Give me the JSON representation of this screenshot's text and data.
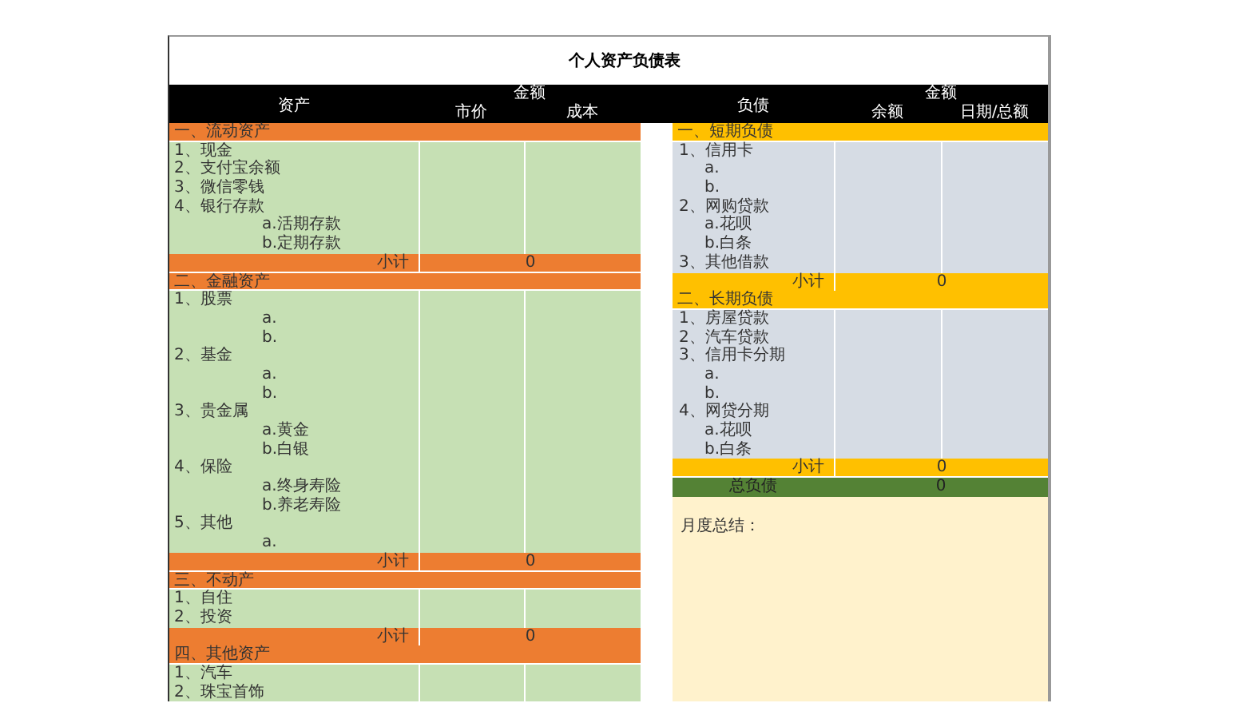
{
  "title": "个人资产负债表",
  "assets": {
    "heading": "资产",
    "amount_heading": "金额",
    "columns": [
      "市价",
      "成本"
    ],
    "sections": [
      {
        "title": "一、流动资产",
        "items": [
          {
            "label": "1、现金"
          },
          {
            "label": "2、支付宝余额"
          },
          {
            "label": "3、微信零钱"
          },
          {
            "label": "4、银行存款",
            "children": [
              {
                "label": "a.活期存款"
              },
              {
                "label": "b.定期存款"
              }
            ]
          }
        ],
        "subtotal": {
          "label": "小计",
          "value": "0"
        }
      },
      {
        "title": "二、金融资产",
        "items": [
          {
            "label": "1、股票",
            "children": [
              {
                "label": "a."
              },
              {
                "label": "b."
              }
            ]
          },
          {
            "label": "2、基金",
            "children": [
              {
                "label": "a."
              },
              {
                "label": "b."
              }
            ]
          },
          {
            "label": "3、贵金属",
            "children": [
              {
                "label": "a.黄金"
              },
              {
                "label": "b.白银"
              }
            ]
          },
          {
            "label": "4、保险",
            "children": [
              {
                "label": "a.终身寿险"
              },
              {
                "label": "b.养老寿险"
              }
            ]
          },
          {
            "label": "5、其他",
            "children": [
              {
                "label": "a."
              }
            ]
          }
        ],
        "subtotal": {
          "label": "小计",
          "value": "0"
        }
      },
      {
        "title": "三、不动产",
        "items": [
          {
            "label": "1、自住"
          },
          {
            "label": "2、投资"
          }
        ],
        "subtotal": {
          "label": "小计",
          "value": "0"
        }
      },
      {
        "title": "四、其他资产",
        "items": [
          {
            "label": "1、汽车"
          },
          {
            "label": "2、珠宝首饰"
          }
        ]
      }
    ]
  },
  "liabilities": {
    "heading": "负债",
    "amount_heading": "金额",
    "columns": [
      "余额",
      "日期/总额"
    ],
    "sections": [
      {
        "title": "一、短期负债",
        "items": [
          {
            "label": "1、信用卡",
            "children": [
              {
                "label": "a."
              },
              {
                "label": "b."
              }
            ]
          },
          {
            "label": "2、网购贷款",
            "children": [
              {
                "label": "a.花呗"
              },
              {
                "label": "b.白条"
              }
            ]
          },
          {
            "label": "3、其他借款"
          }
        ],
        "subtotal": {
          "label": "小计",
          "value": "0"
        }
      },
      {
        "title": "二、长期负债",
        "items": [
          {
            "label": "1、房屋贷款"
          },
          {
            "label": "2、汽车贷款"
          },
          {
            "label": "3、信用卡分期",
            "children": [
              {
                "label": "a."
              },
              {
                "label": "b."
              }
            ]
          },
          {
            "label": "4、网贷分期",
            "children": [
              {
                "label": "a.花呗"
              },
              {
                "label": "b.白条"
              }
            ]
          }
        ],
        "subtotal": {
          "label": "小计",
          "value": "0"
        }
      }
    ],
    "total": {
      "label": "总负债",
      "value": "0"
    },
    "summary": {
      "label": "月度总结："
    }
  }
}
